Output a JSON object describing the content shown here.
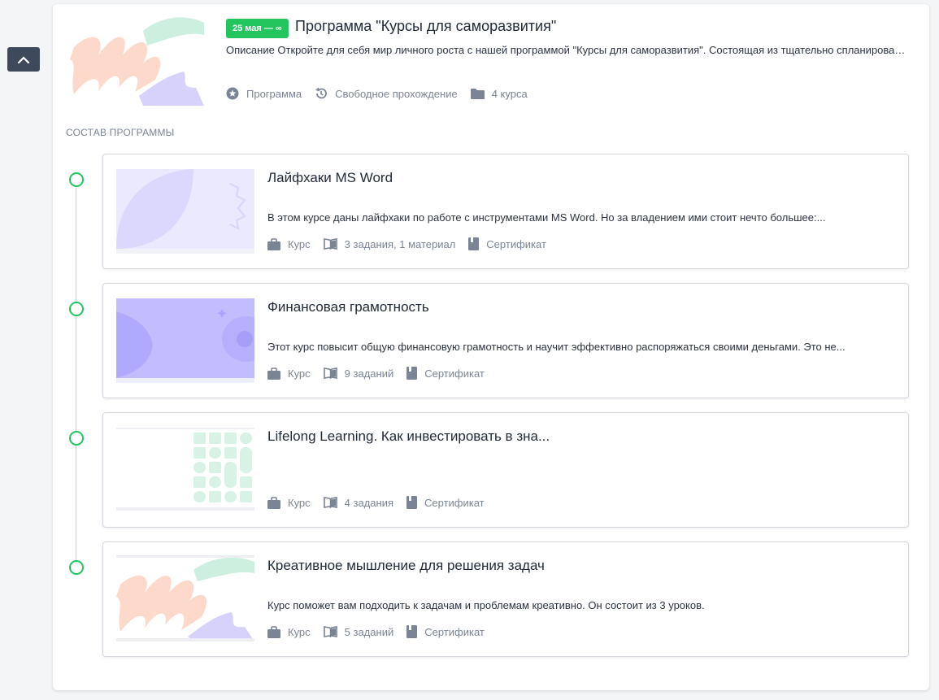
{
  "program": {
    "badge": "25 мая — ∞",
    "title": "Программа \"Курсы для саморазвития\"",
    "description": "Описание Откройте для себя мир личного роста с нашей программой \"Курсы для саморазвития\". Состоящая из тщательно спланированных курсов...",
    "meta": {
      "type": "Программа",
      "mode": "Свободное прохождение",
      "count": "4 курса"
    }
  },
  "section_label": "СОСТАВ ПРОГРАММЫ",
  "courses": [
    {
      "title": "Лайфхаки MS Word",
      "description": "В этом курсе даны лайфхаки по работе с инструментами MS Word. Но за владением ими стоит нечто большее:...",
      "type": "Курс",
      "tasks": "3 задания, 1 материал",
      "certificate": "Сертификат"
    },
    {
      "title": "Финансовая грамотность",
      "description": "Этот курс повысит общую финансовую грамотность и научит эффективно распоряжаться своими деньгами. Это не...",
      "type": "Курс",
      "tasks": "9 заданий",
      "certificate": "Сертификат"
    },
    {
      "title": "Lifelong Learning. Как инвестировать в зна...",
      "description": "",
      "type": "Курс",
      "tasks": "4 задания",
      "certificate": "Сертификат"
    },
    {
      "title": "Креативное мышление для решения задач",
      "description": "Курс поможет вам подходить к задачам и проблемам креативно. Он состоит из 3 уроков.",
      "type": "Курс",
      "tasks": "5 заданий",
      "certificate": "Сертификат"
    }
  ],
  "colors": {
    "accent": "#22c55e",
    "meta_text": "#7a8494",
    "scroll_button": "#3e4a5b"
  },
  "icons": [
    "chevron-up-icon",
    "star-icon",
    "history-icon",
    "folder-icon",
    "briefcase-icon",
    "book-icon",
    "bookmark-icon"
  ]
}
